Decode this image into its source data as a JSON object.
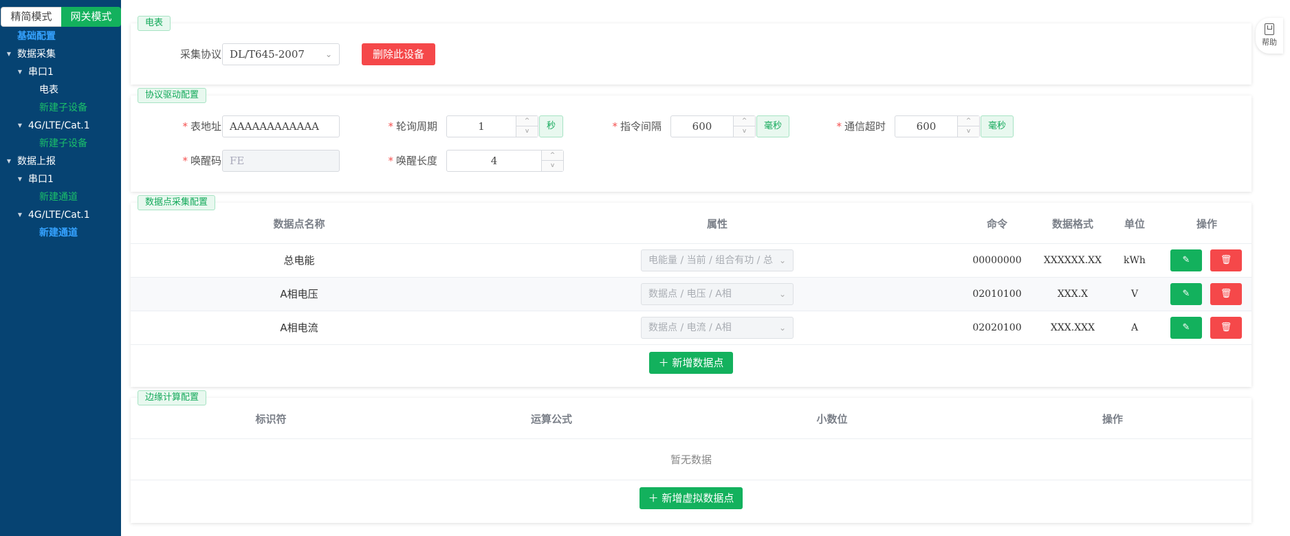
{
  "mode_tabs": {
    "simple": "精简模式",
    "gateway": "网关模式"
  },
  "tree": {
    "basic": "基础配置",
    "collect": "数据采集",
    "collect_serial": "串口1",
    "meter": "电表",
    "new_sub_device_1": "新建子设备",
    "collect_lte": "4G/LTE/Cat.1",
    "new_sub_device_2": "新建子设备",
    "report": "数据上报",
    "report_serial": "串口1",
    "new_channel_1": "新建通道",
    "report_lte": "4G/LTE/Cat.1",
    "new_channel_2": "新建通道"
  },
  "meter_card": {
    "tag": "电表",
    "protocol_label": "采集协议",
    "protocol_value": "DL/T645-2007",
    "delete_button": "删除此设备"
  },
  "driver_card": {
    "tag": "协议驱动配置",
    "address_label": "表地址",
    "address_value": "AAAAAAAAAAAA",
    "poll_label": "轮询周期",
    "poll_value": "1",
    "poll_unit": "秒",
    "interval_label": "指令间隔",
    "interval_value": "600",
    "interval_unit": "毫秒",
    "timeout_label": "通信超时",
    "timeout_value": "600",
    "timeout_unit": "毫秒",
    "wake_code_label": "唤醒码",
    "wake_code_value": "FE",
    "wake_len_label": "唤醒长度",
    "wake_len_value": "4"
  },
  "points_card": {
    "tag": "数据点采集配置",
    "headers": {
      "name": "数据点名称",
      "prop": "属性",
      "cmd": "命令",
      "format": "数据格式",
      "unit": "单位",
      "ops": "操作"
    },
    "rows": [
      {
        "name": "总电能",
        "prop": "电能量 / 当前 / 组合有功 / 总",
        "cmd": "00000000",
        "format": "XXXXXX.XX",
        "unit": "kWh"
      },
      {
        "name": "A相电压",
        "prop": "数据点 / 电压 / A相",
        "cmd": "02010100",
        "format": "XXX.X",
        "unit": "V"
      },
      {
        "name": "A相电流",
        "prop": "数据点 / 电流 / A相",
        "cmd": "02020100",
        "format": "XXX.XXX",
        "unit": "A"
      }
    ],
    "add_button": "新增数据点"
  },
  "edge_card": {
    "tag": "边缘计算配置",
    "headers": {
      "id": "标识符",
      "formula": "运算公式",
      "decimals": "小数位",
      "ops": "操作"
    },
    "empty": "暂无数据",
    "add_button": "新增虚拟数据点"
  },
  "help": {
    "label": "帮助"
  },
  "colors": {
    "sidebar": "#064372",
    "primary": "#13b15d",
    "danger": "#f5484a",
    "link": "#35a2ff"
  }
}
